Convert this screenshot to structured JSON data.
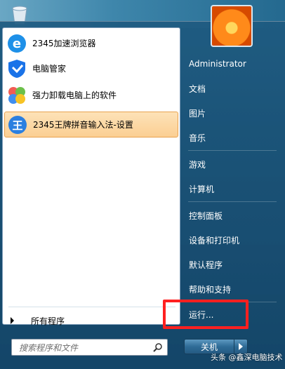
{
  "left_panel": {
    "programs": [
      {
        "label": "2345加速浏览器",
        "icon": "browser-e-icon"
      },
      {
        "label": "电脑管家",
        "icon": "shield-icon"
      },
      {
        "label": "强力卸载电脑上的软件",
        "icon": "pinwheel-icon"
      },
      {
        "label": "2345王牌拼音输入法-设置",
        "icon": "ime-wang-icon",
        "selected": true
      }
    ],
    "all_programs_label": "所有程序",
    "search_placeholder": "搜索程序和文件"
  },
  "right_panel": {
    "items": [
      {
        "label": "Administrator"
      },
      {
        "label": "文档"
      },
      {
        "label": "图片"
      },
      {
        "label": "音乐"
      },
      {
        "label": "游戏"
      },
      {
        "label": "计算机"
      },
      {
        "label": "控制面板"
      },
      {
        "label": "设备和打印机"
      },
      {
        "label": "默认程序"
      },
      {
        "label": "帮助和支持"
      },
      {
        "label": "运行..."
      }
    ],
    "shutdown_label": "关机"
  },
  "watermark": "头条 @鑫深电脑技术",
  "colors": {
    "selection": "#fbcf93",
    "highlight_box": "#ff2020",
    "menu_bg": "#1f5674"
  }
}
